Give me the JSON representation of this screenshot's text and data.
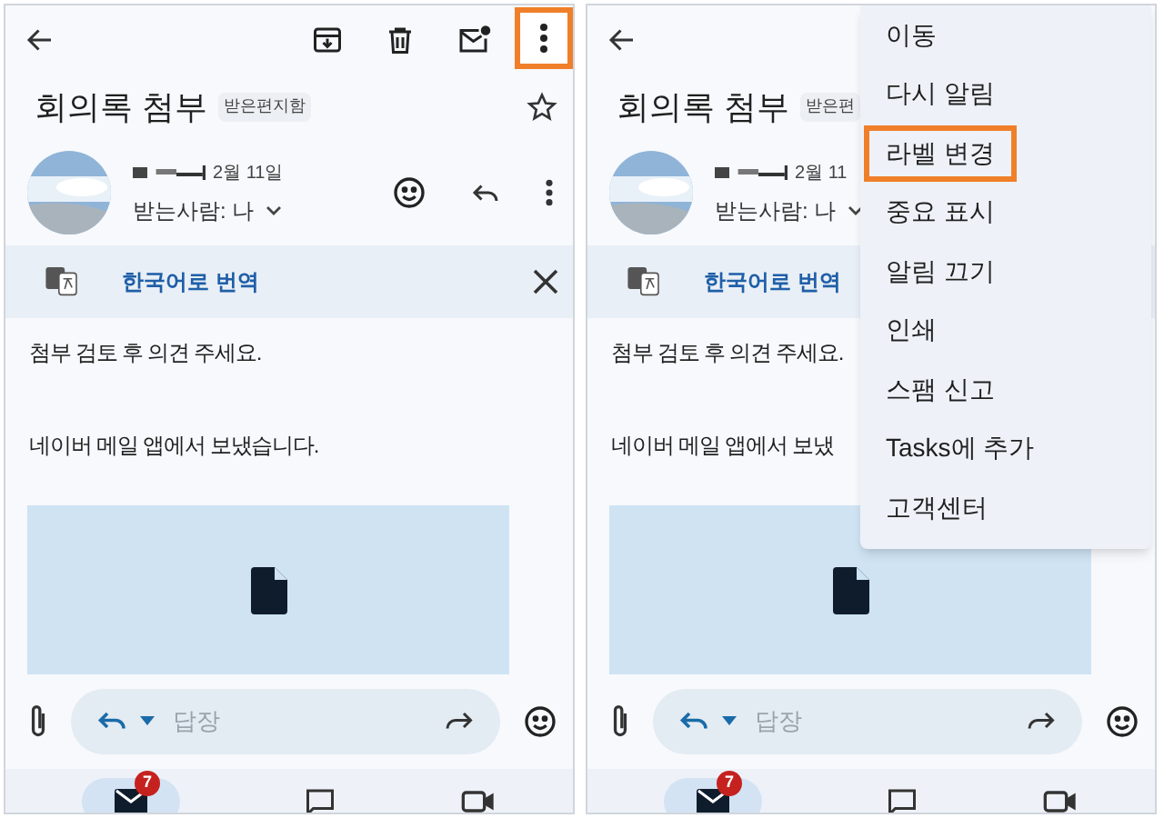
{
  "panels": [
    {
      "subject": "회의록 첨부",
      "label": "받은편지함",
      "date": "2월 11일",
      "recipient": "받는사람: 나",
      "translate": "한국어로 번역",
      "body": [
        "첨부 검토 후 의견 주세요.",
        "네이버 메일 앱에서 보냈습니다."
      ],
      "reply_placeholder": "답장",
      "unread_badge": "7",
      "more_highlighted": true
    },
    {
      "subject": "회의록 첨부",
      "label": "받은편",
      "date": "2월 11",
      "recipient": "받는사람: 나",
      "translate": "한국어로 번역",
      "body": [
        "첨부 검토 후 의견 주세요.",
        "네이버 메일 앱에서 보냈"
      ],
      "reply_placeholder": "답장",
      "unread_badge": "7",
      "menu": {
        "items": [
          {
            "label": "이동",
            "highlighted": false
          },
          {
            "label": "다시 알림",
            "highlighted": false
          },
          {
            "label": "라벨 변경",
            "highlighted": true
          },
          {
            "label": "중요 표시",
            "highlighted": false
          },
          {
            "label": "알림 끄기",
            "highlighted": false
          },
          {
            "label": "인쇄",
            "highlighted": false
          },
          {
            "label": "스팸 신고",
            "highlighted": false
          },
          {
            "label": "Tasks에 추가",
            "highlighted": false
          },
          {
            "label": "고객센터",
            "highlighted": false
          }
        ]
      }
    }
  ]
}
